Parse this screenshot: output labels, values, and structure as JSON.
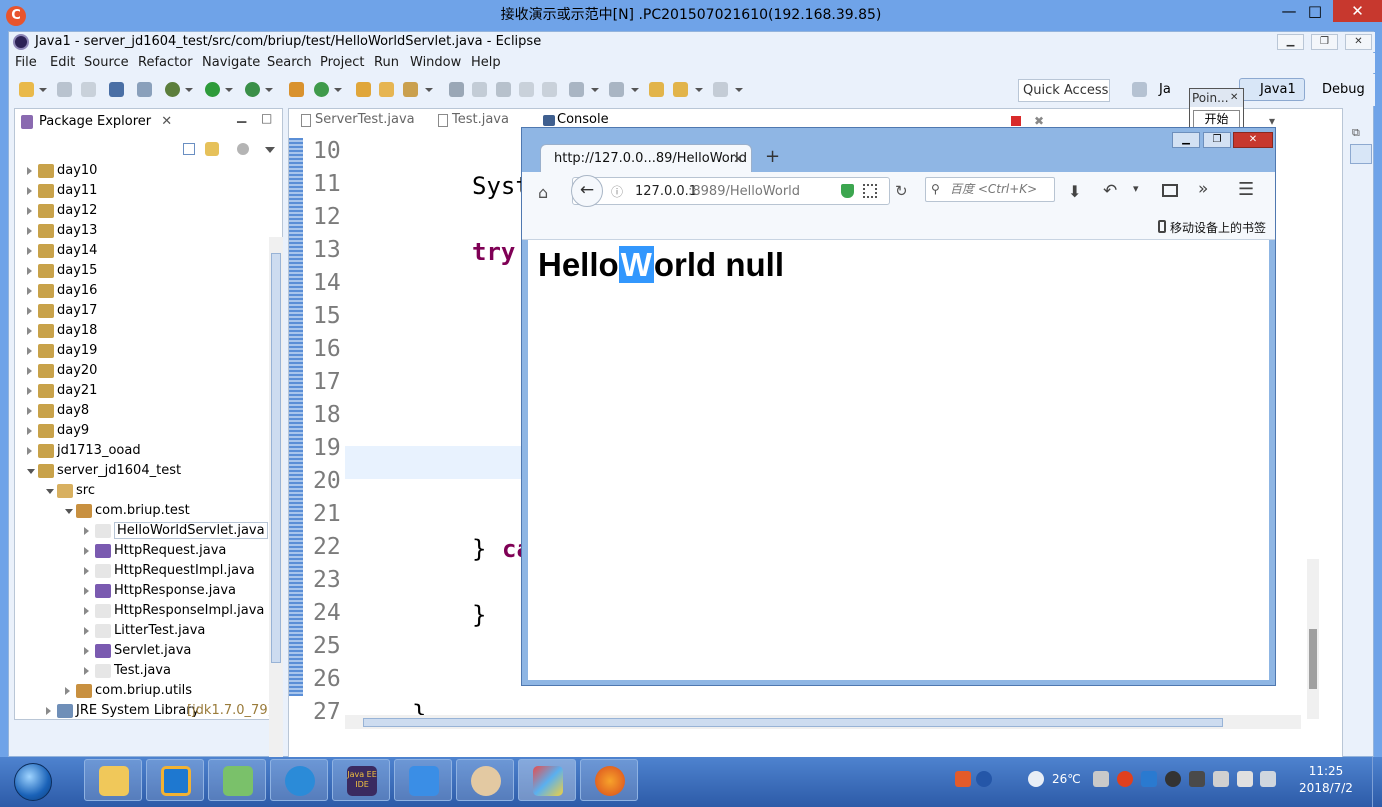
{
  "remote": {
    "title": "接收演示或示范中[N] .PC201507021610(192.168.39.85)",
    "min": "—",
    "max": "□",
    "close": "✕"
  },
  "eclipse": {
    "title": "Java1 - server_jd1604_test/src/com/briup/test/HelloWorldServlet.java - Eclipse",
    "menu": [
      "File",
      "Edit",
      "Source",
      "Refactor",
      "Navigate",
      "Search",
      "Project",
      "Run",
      "Window",
      "Help"
    ],
    "quick_access": "Quick Access",
    "perspectives": {
      "java": "Ja",
      "java1": "Java1",
      "debug": "Debug"
    }
  },
  "package_explorer": {
    "tab": "Package Explorer",
    "projects": [
      "day10",
      "day11",
      "day12",
      "day13",
      "day14",
      "day15",
      "day16",
      "day17",
      "day18",
      "day19",
      "day20",
      "day21",
      "day8",
      "day9",
      "jd1713_ooad",
      "server_jd1604_test"
    ],
    "src": "src",
    "package": "com.briup.test",
    "files": [
      "HelloWorldServlet.java",
      "HttpRequest.java",
      "HttpRequestImpl.java",
      "HttpResponse.java",
      "HttpResponseImpl.java",
      "LitterTest.java",
      "Servlet.java",
      "Test.java"
    ],
    "package2": "com.briup.utils",
    "jre": "JRE System Library",
    "jre_version": "[jdk1.7.0_79]"
  },
  "editor": {
    "tabs": [
      "ServerTest.java",
      "Test.java",
      "Console"
    ],
    "line_numbers": [
      "10",
      "11",
      "12",
      "13",
      "14",
      "15",
      "16",
      "17",
      "18",
      "19",
      "20",
      "21",
      "22",
      "23",
      "24",
      "25",
      "26",
      "27"
    ],
    "code": {
      "l10": "Syst",
      "l12": "try",
      "l21_brace": "}",
      "l21_kw": "ca",
      "l23": "}",
      "l26": "}"
    }
  },
  "pointer_popup": {
    "title": "Poin...",
    "button": "开始"
  },
  "firefox": {
    "tab_title": "http://127.0.0...89/HelloWorld",
    "url_host": "127.0.0.1",
    "url_rest": ":8989/HelloWorld",
    "search_placeholder": "百度 <Ctrl+K>",
    "mobile_bookmarks": "移动设备上的书签",
    "page": {
      "before": "Hello",
      "selected": "W",
      "after": "orld null"
    }
  },
  "taskbar": {
    "temperature": "26℃",
    "time": "11:25",
    "date": "2018/7/2",
    "java_ee_label": "Java EE IDE"
  }
}
